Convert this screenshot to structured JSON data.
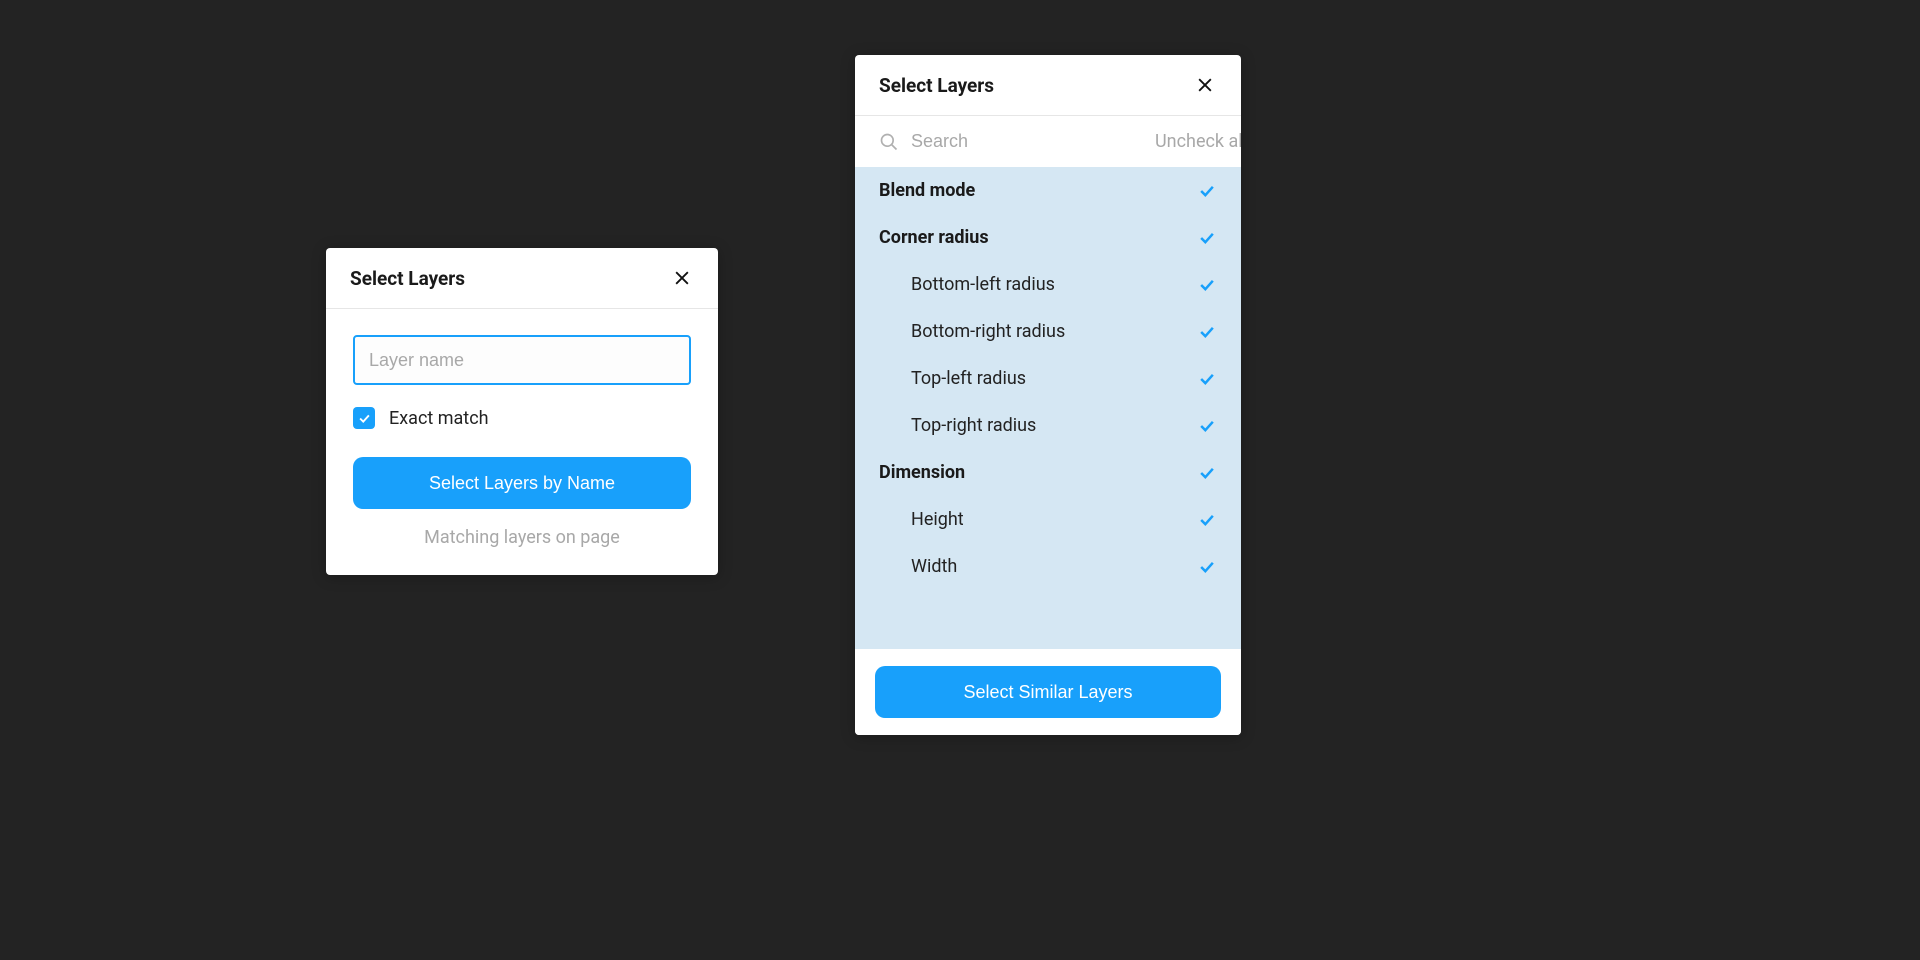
{
  "left": {
    "title": "Select Layers",
    "input_placeholder": "Layer name",
    "exact_match_label": "Exact match",
    "exact_match_checked": true,
    "button_label": "Select Layers by Name",
    "hint": "Matching layers on page"
  },
  "right": {
    "title": "Select Layers",
    "search_placeholder": "Search",
    "uncheck_all_label": "Uncheck all",
    "button_label": "Select Similar Layers",
    "items": [
      {
        "label": "Blend mode",
        "group": true,
        "checked": true
      },
      {
        "label": "Corner radius",
        "group": true,
        "checked": true
      },
      {
        "label": "Bottom-left radius",
        "group": false,
        "checked": true
      },
      {
        "label": "Bottom-right radius",
        "group": false,
        "checked": true
      },
      {
        "label": "Top-left radius",
        "group": false,
        "checked": true
      },
      {
        "label": "Top-right radius",
        "group": false,
        "checked": true
      },
      {
        "label": "Dimension",
        "group": true,
        "checked": true
      },
      {
        "label": "Height",
        "group": false,
        "checked": true
      },
      {
        "label": "Width",
        "group": false,
        "checked": true
      }
    ]
  }
}
